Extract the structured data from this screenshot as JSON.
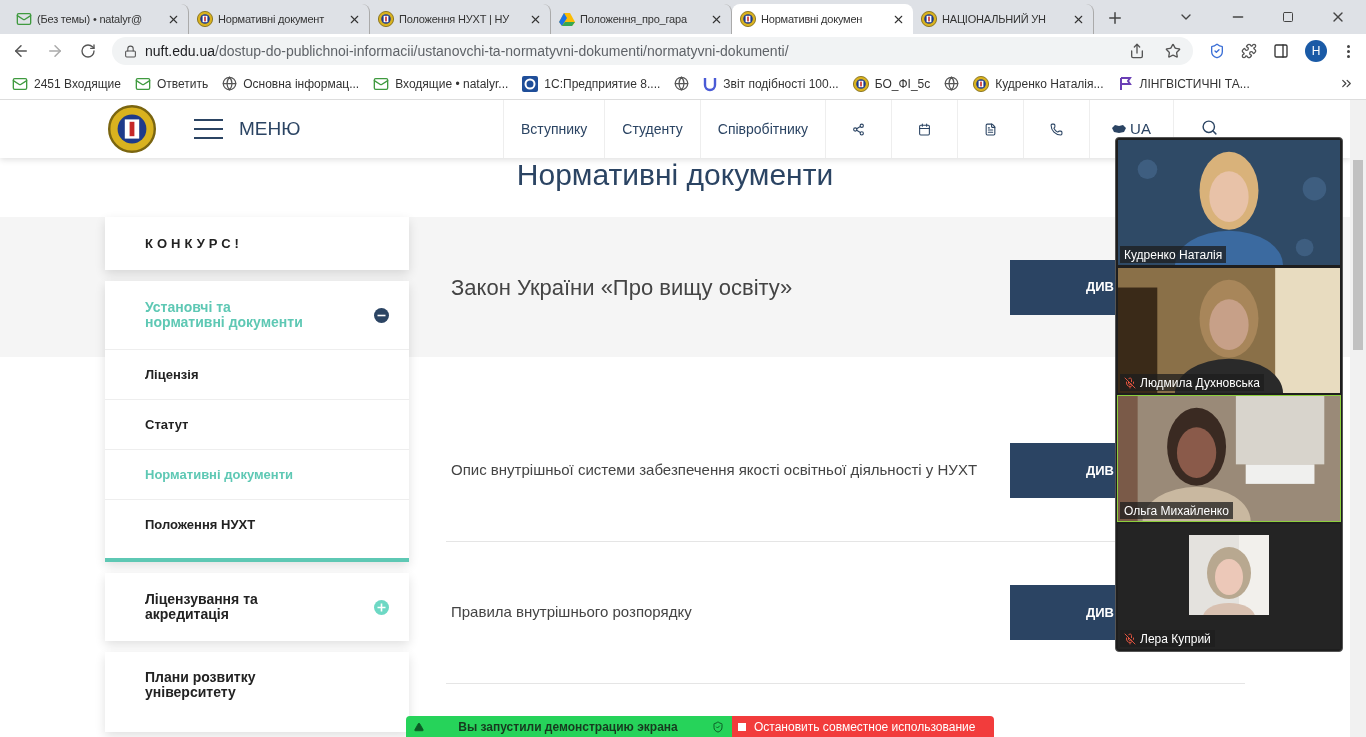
{
  "browser": {
    "tabs": [
      {
        "kind": "mail",
        "title": "(Без темы) • natalyr@",
        "selected": false
      },
      {
        "kind": "emblem",
        "title": "Нормативні документ",
        "selected": false
      },
      {
        "kind": "emblem",
        "title": "Положення НУХТ | НУ",
        "selected": false
      },
      {
        "kind": "drive",
        "title": "Положення_про_гара",
        "selected": false
      },
      {
        "kind": "emblem",
        "title": "Нормативні докумен",
        "selected": true
      },
      {
        "kind": "emblem",
        "title": "НАЦІОНАЛЬНИЙ УН",
        "selected": false
      }
    ],
    "url_host": "nuft.edu.ua",
    "url_path": "/dostup-do-publichnoi-informacii/ustanovchi-ta-normatyvni-dokumenti/normatyvni-dokumenti/",
    "profile": "Н",
    "bookmarks": [
      {
        "kind": "mail",
        "label": "2451 Входящие"
      },
      {
        "kind": "mail",
        "label": "Ответить"
      },
      {
        "kind": "globe",
        "label": "Основна інформац..."
      },
      {
        "kind": "mail",
        "label": "Входящие • natalyr..."
      },
      {
        "kind": "onec",
        "label": "1С:Предприятие 8...."
      },
      {
        "kind": "globe"
      },
      {
        "kind": "u",
        "label": "Звіт подібності 100..."
      },
      {
        "kind": "emblem",
        "label": "БО_ФІ_5с"
      },
      {
        "kind": "globe"
      },
      {
        "kind": "emblem",
        "label": "Кудренко Наталія..."
      },
      {
        "kind": "ling",
        "label": "ЛІНГВІСТИЧНІ ТА..."
      }
    ]
  },
  "header": {
    "menu_label": "МЕНЮ",
    "nav": [
      "Вступнику",
      "Студенту",
      "Співробітнику"
    ],
    "language": "UA"
  },
  "page_title": "Нормативні документи",
  "sidebar": [
    {
      "kind": "link",
      "label": "КОНКУРС!"
    },
    {
      "kind": "group",
      "label": "Установчі та нормативні документи",
      "expanded": true,
      "items": [
        {
          "label": "Ліцензія",
          "selected": false
        },
        {
          "label": "Статут",
          "selected": false
        },
        {
          "label": "Нормативні документи",
          "selected": true
        },
        {
          "label": "Положення НУХТ",
          "selected": false
        }
      ]
    },
    {
      "kind": "group",
      "label": "Ліцензування та акредитація",
      "expanded": false
    },
    {
      "kind": "link",
      "label": "Плани розвитку університету"
    }
  ],
  "documents": [
    {
      "kind": "featured",
      "title": "Закон України «Про вищу освіту»",
      "button": "ДИВ"
    },
    {
      "kind": "regular",
      "title": "Опис внутрішньої системи забезпечення якості освітньої діяльності у НУХТ",
      "button": "ДИВ"
    },
    {
      "kind": "regular",
      "title": "Правила внутрішнього розпорядку",
      "button": "ДИВ"
    }
  ],
  "participants": [
    {
      "kind": "video",
      "name": "Кудренко Наталія",
      "muted": false,
      "speaking": false
    },
    {
      "kind": "video",
      "name": "Людмила Духновська",
      "muted": true,
      "speaking": false
    },
    {
      "kind": "video",
      "name": "Ольга Михайленко",
      "muted": false,
      "speaking": true
    },
    {
      "kind": "avatar",
      "name": "Лера Куприй",
      "muted": true,
      "speaking": false
    }
  ],
  "share_bar": {
    "status": "Вы запустили демонстрацию экрана",
    "stop": "Остановить совместное использование"
  }
}
